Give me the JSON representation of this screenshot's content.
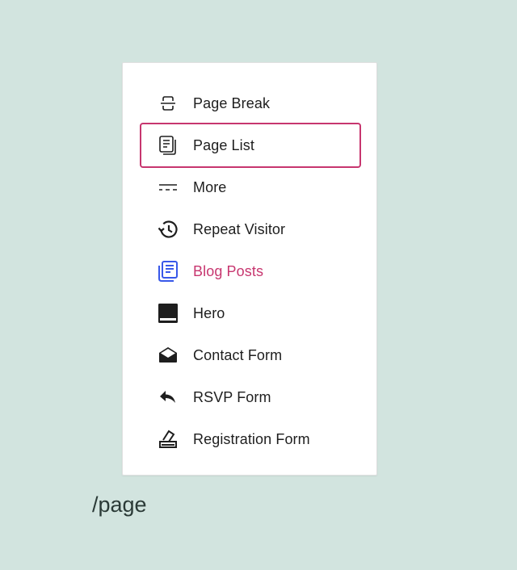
{
  "inserter": {
    "items": [
      {
        "label": "Page Break",
        "icon": "page-break-icon"
      },
      {
        "label": "Page List",
        "icon": "page-list-icon",
        "selected": true
      },
      {
        "label": "More",
        "icon": "more-icon"
      },
      {
        "label": "Repeat Visitor",
        "icon": "history-icon"
      },
      {
        "label": "Blog Posts",
        "icon": "blog-posts-icon",
        "accent": true
      },
      {
        "label": "Hero",
        "icon": "hero-icon"
      },
      {
        "label": "Contact Form",
        "icon": "envelope-icon"
      },
      {
        "label": "RSVP Form",
        "icon": "reply-icon"
      },
      {
        "label": "Registration Form",
        "icon": "ballot-box-icon"
      }
    ]
  },
  "editor": {
    "query": "/page"
  },
  "colors": {
    "background": "#d2e4df",
    "selection_border": "#c7366f",
    "accent_text": "#c7366f",
    "accent_icon": "#3858e9"
  }
}
